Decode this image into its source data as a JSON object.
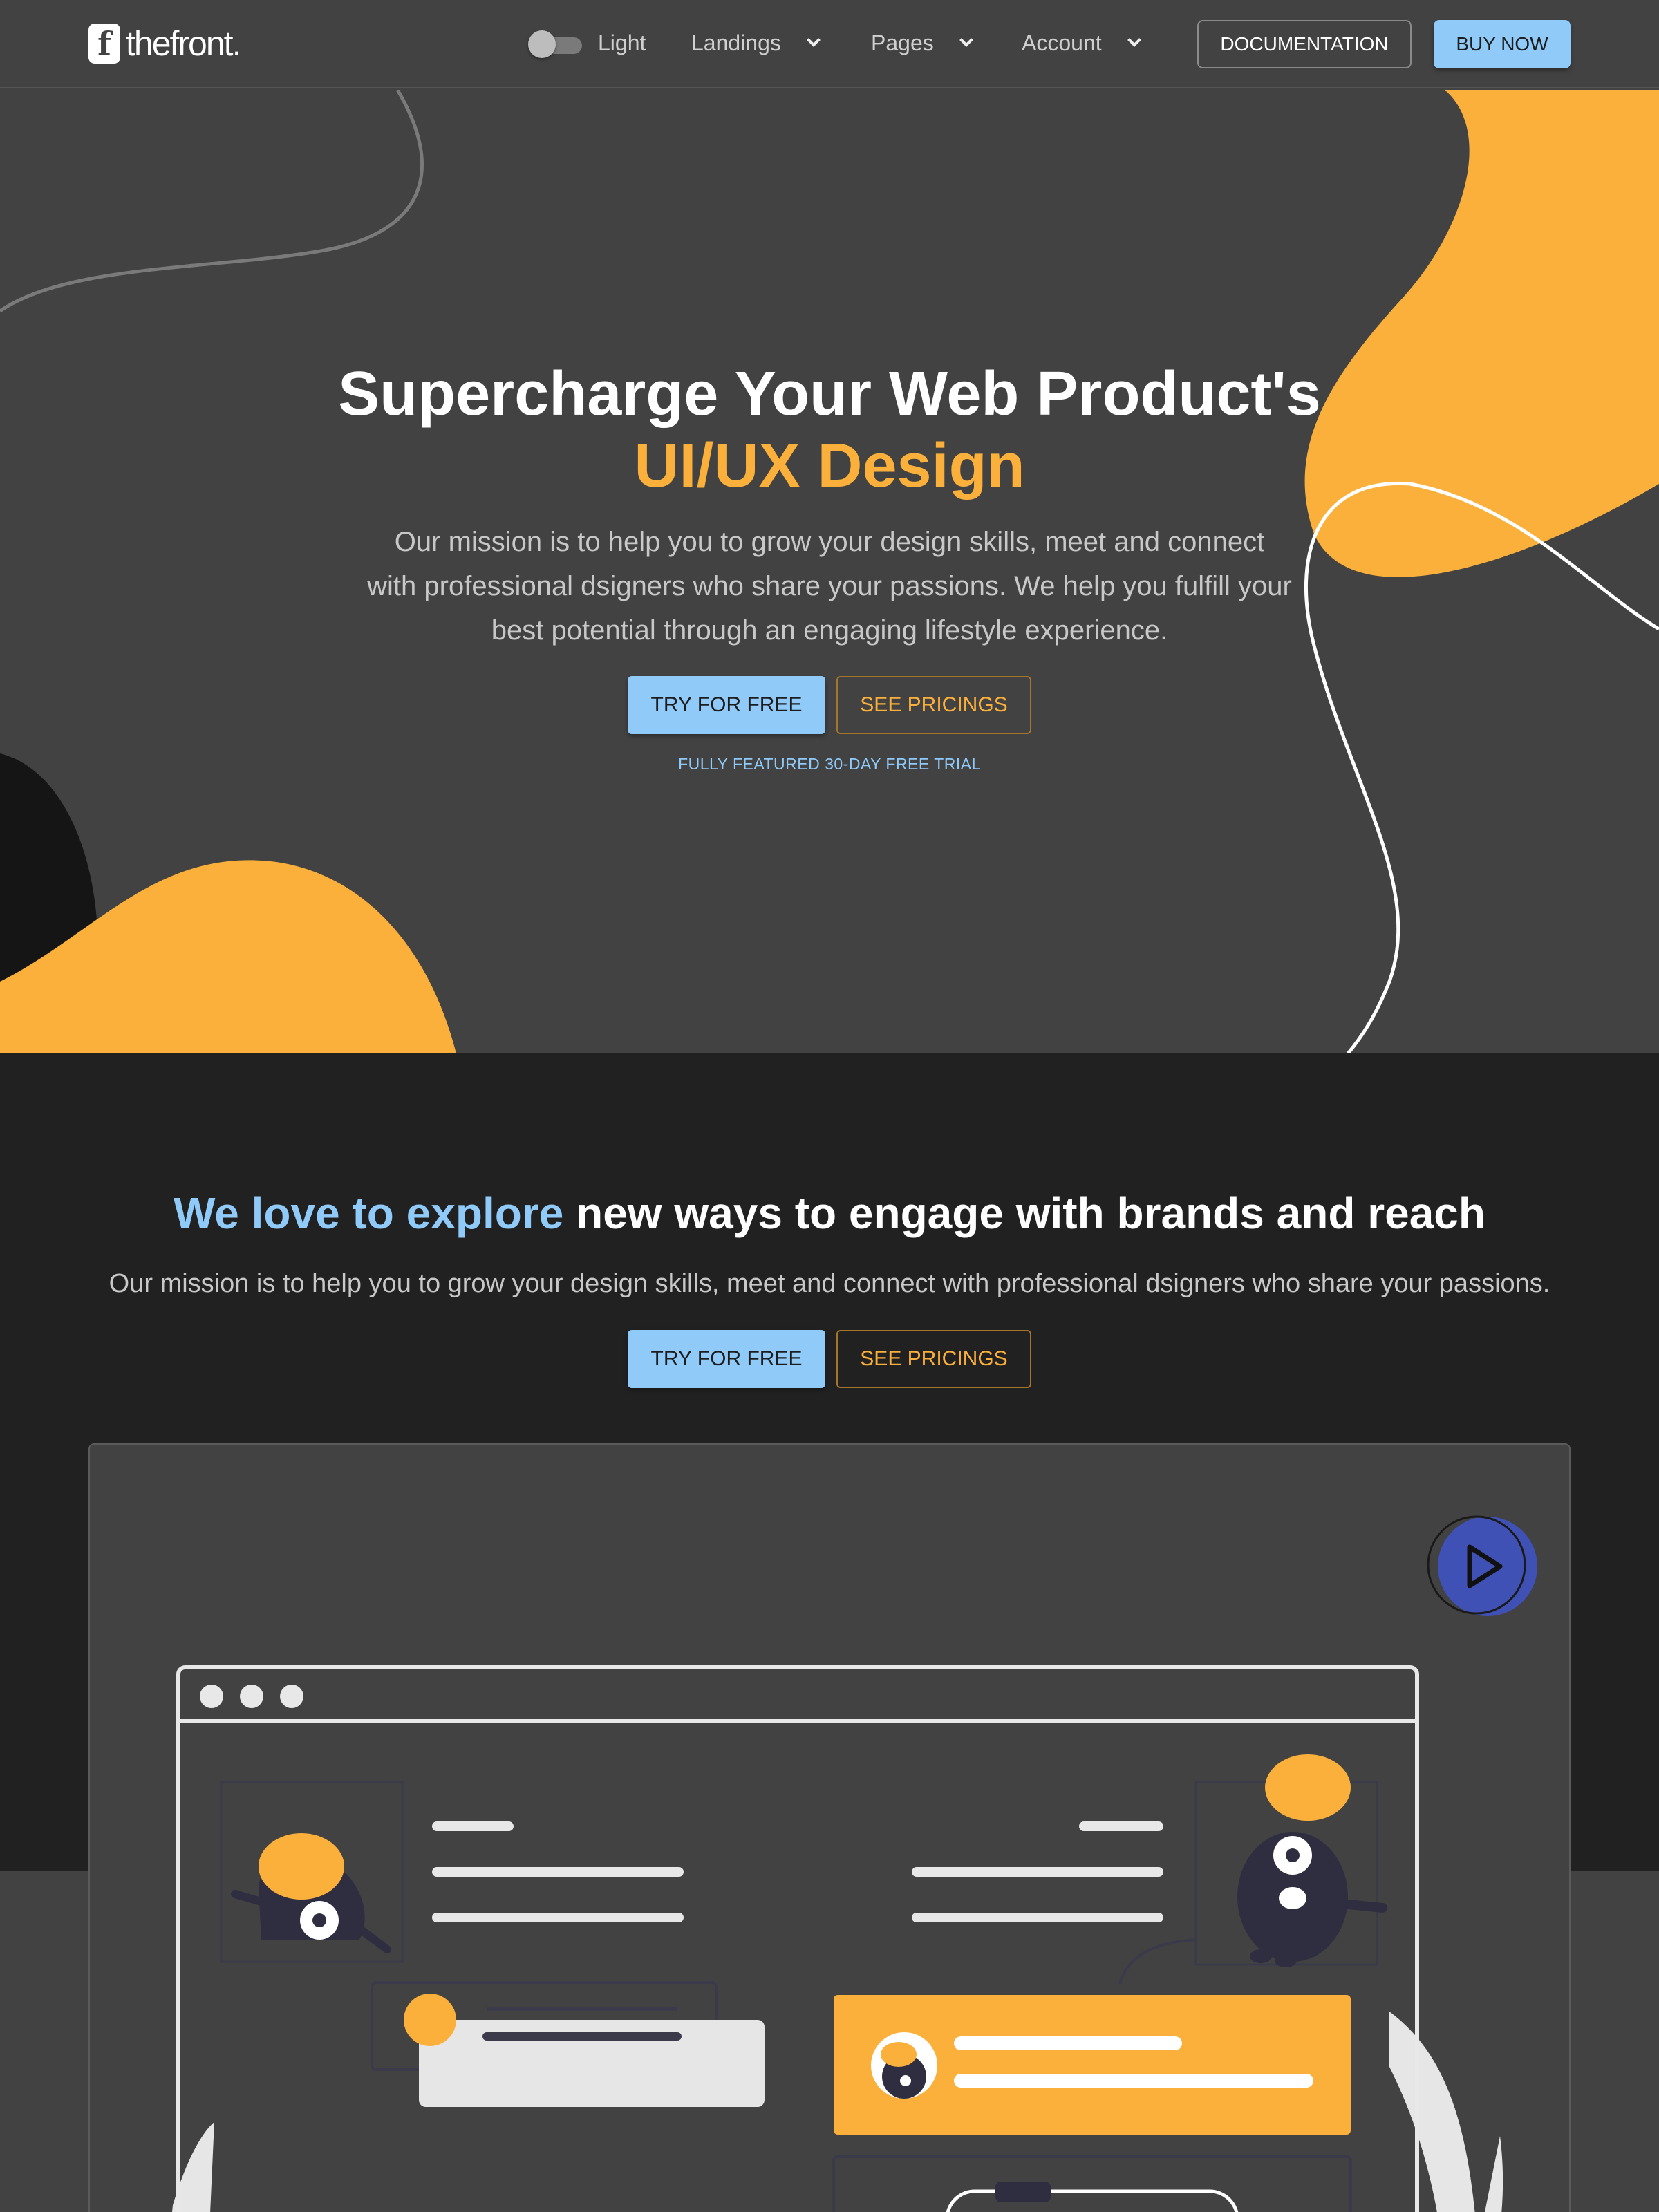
{
  "nav": {
    "logo_text": "thefront",
    "logo_mark": "f",
    "theme_label": "Light",
    "items": [
      {
        "label": "Landings"
      },
      {
        "label": "Pages"
      },
      {
        "label": "Account"
      }
    ],
    "documentation_label": "DOCUMENTATION",
    "buy_label": "BUY NOW"
  },
  "hero": {
    "title_line1": "Supercharge Your Web Product's",
    "title_line2": "UI/UX Design",
    "subtitle": "Our mission is to help you to grow your design skills, meet and connect with professional dsigners who share your passions. We help you fulfill your best potential through an engaging lifestyle experience.",
    "try_label": "TRY FOR FREE",
    "pricing_label": "SEE PRICINGS",
    "trial_note": "FULLY FEATURED 30-DAY FREE TRIAL"
  },
  "section2": {
    "title_highlight": "We love to explore",
    "title_rest": " new ways to engage with brands and reach",
    "subtitle": "Our mission is to help you to grow your design skills, meet and connect with professional dsigners who share your passions.",
    "try_label": "TRY FOR FREE",
    "pricing_label": "SEE PRICINGS"
  },
  "video": {
    "play_icon": "play-icon"
  },
  "colors": {
    "accent_yellow": "#fbb03b",
    "accent_blue": "#90caf9",
    "dark_bg": "#212121",
    "panel_bg": "#424242",
    "play_blue": "#3f51b5"
  }
}
